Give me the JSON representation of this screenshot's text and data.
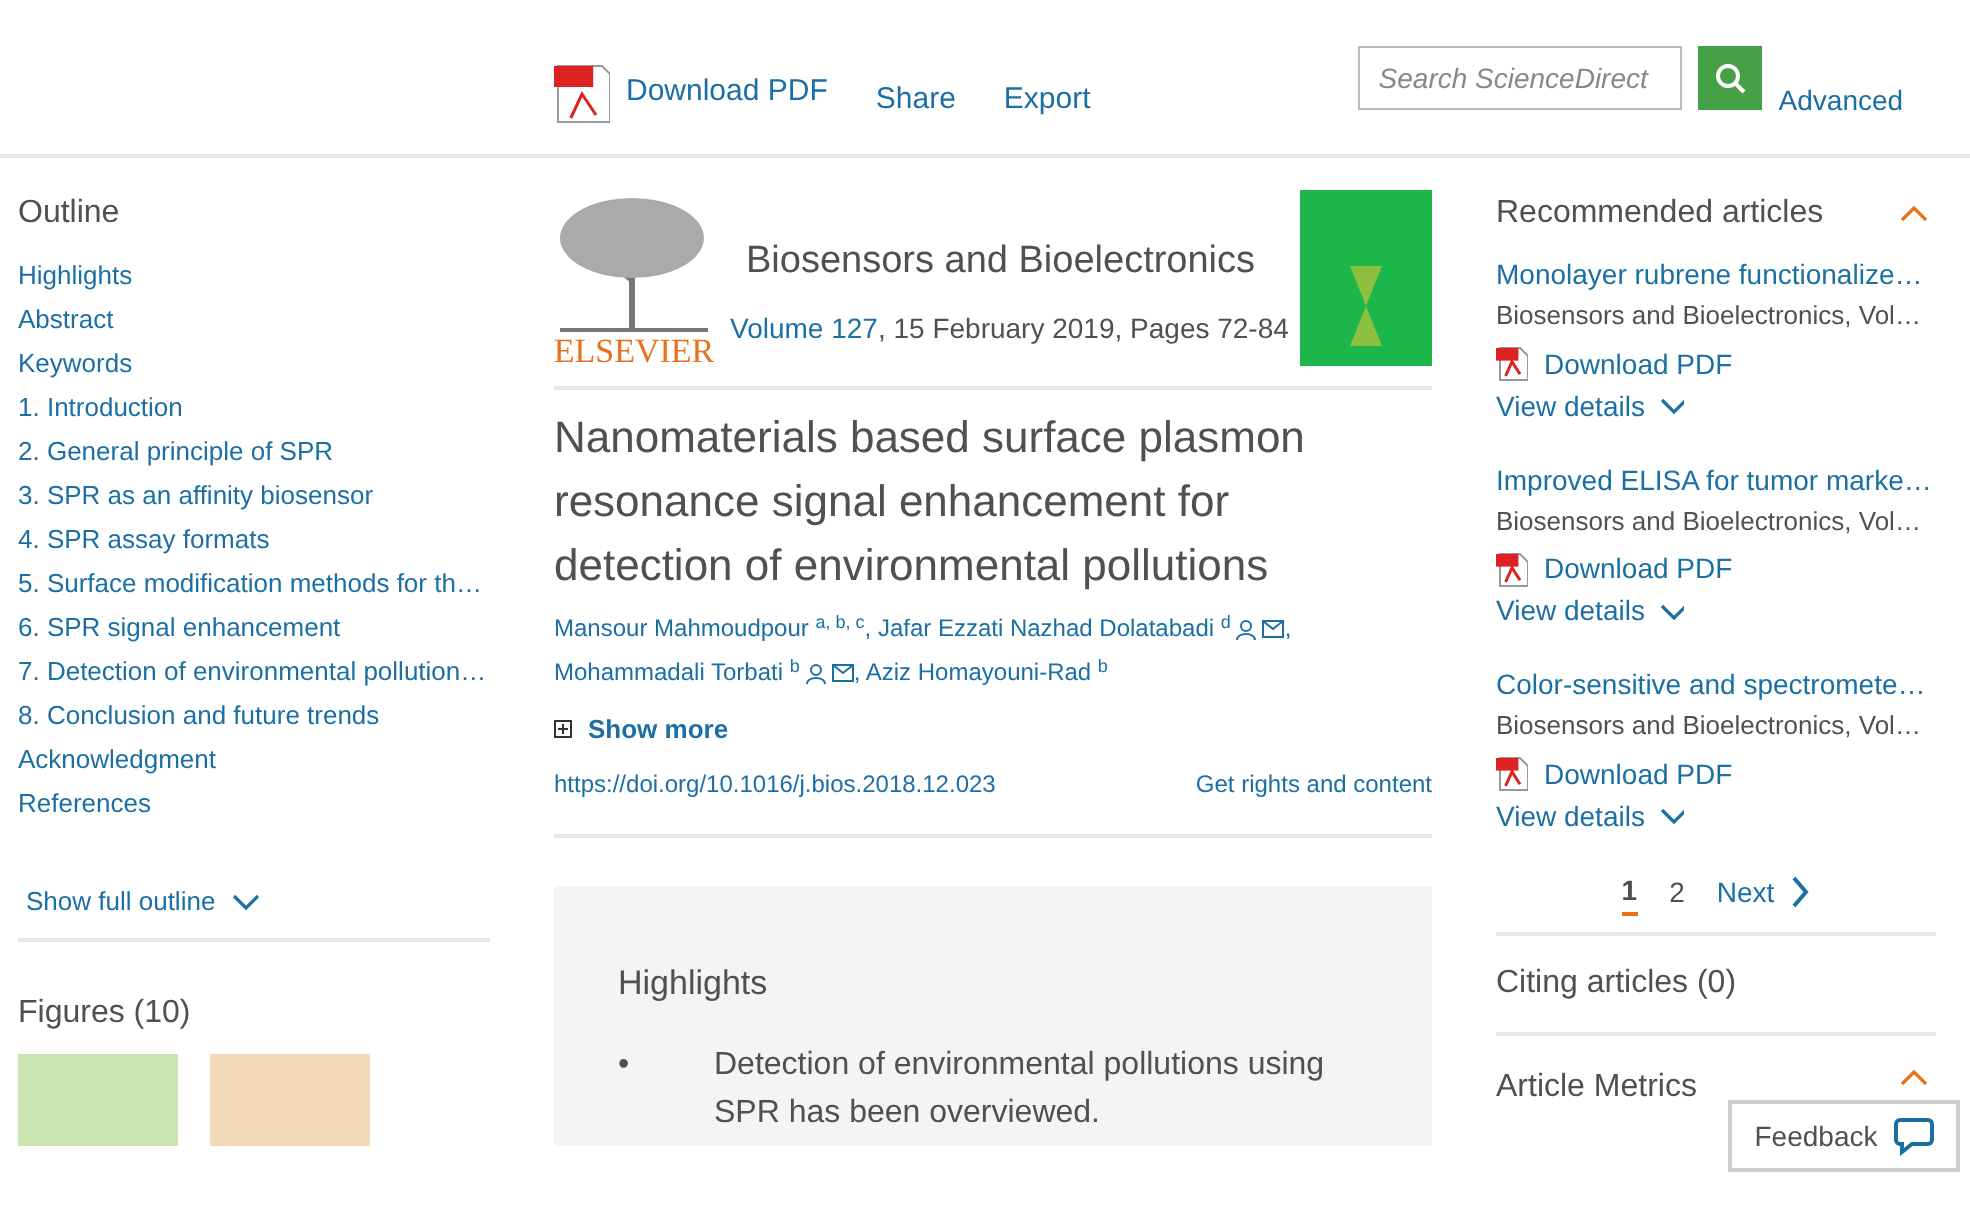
{
  "toolbar": {
    "download": "Download PDF",
    "share": "Share",
    "export": "Export",
    "search": {
      "placeholder": "Search ScienceDirect"
    },
    "advanced": "Advanced"
  },
  "outline": {
    "title": "Outline",
    "items": [
      "Highlights",
      "Abstract",
      "Keywords",
      "1. Introduction",
      "2. General principle of SPR",
      "3. SPR as an affinity biosensor",
      "4. SPR assay formats",
      "5. Surface modification methods for th…",
      "6. SPR signal enhancement",
      "7. Detection of environmental pollution…",
      "8. Conclusion and future trends",
      "Acknowledgment",
      "References"
    ],
    "show_full": "Show full outline",
    "expanded": false
  },
  "figures": {
    "title": "Figures (10)",
    "thumbs": [
      {
        "color": "#c9e6b0"
      },
      {
        "color": "#f3d8b8"
      }
    ]
  },
  "journal": {
    "publisher": "ELSEVIER",
    "name": "Biosensors and Bioelectronics",
    "volume": "Volume 127",
    "issue_info": ", 15 February 2019, Pages 72-84"
  },
  "article": {
    "title": "Nanomaterials based surface plasmon resonance signal enhancement for detection of environmental pollutions",
    "authors": [
      {
        "name": "Mansour Mahmoudpour",
        "affil": "a, b, c",
        "contact": false,
        "separator": ","
      },
      {
        "name": "Jafar Ezzati Nazhad Dolatabadi",
        "affil": "d",
        "contact": true,
        "separator": ","
      },
      {
        "name": "Mohammadali Torbati",
        "affil": "b",
        "contact": true,
        "separator": ","
      },
      {
        "name": "Aziz Homayouni-Rad",
        "affil": "b",
        "contact": false
      }
    ],
    "show_more": "Show more",
    "doi": "https://doi.org/10.1016/j.bios.2018.12.023",
    "rights": "Get rights and content"
  },
  "highlights": {
    "title": "Highlights",
    "items": [
      {
        "bullet": "•",
        "text": "Detection of environmental pollutions using SPR has been overviewed."
      }
    ]
  },
  "recommended": {
    "title": "Recommended articles",
    "expanded": true,
    "items": [
      {
        "title": "Monolayer rubrene functionalize…",
        "source": "Biosensors and Bioelectronics, Vol…",
        "download": "Download PDF",
        "details": "View details"
      },
      {
        "title": "Improved ELISA for tumor marke…",
        "source": "Biosensors and Bioelectronics, Vol…",
        "download": "Download PDF",
        "details": "View details"
      },
      {
        "title": "Color-sensitive and spectromete…",
        "source": "Biosensors and Bioelectronics, Vol…",
        "download": "Download PDF",
        "details": "View details"
      }
    ],
    "pages": [
      {
        "label": "1",
        "selected": true
      },
      {
        "label": "2",
        "selected": false
      }
    ],
    "next": "Next"
  },
  "citing": {
    "title": "Citing articles (0)"
  },
  "metrics": {
    "title": "Article Metrics",
    "expanded": true
  },
  "feedback": "Feedback"
}
